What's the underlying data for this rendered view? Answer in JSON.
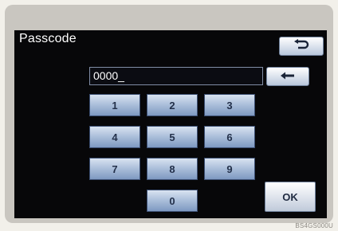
{
  "header": {
    "title": "Passcode",
    "back_icon": "return-arrow-icon"
  },
  "entry": {
    "value": "0000_",
    "backspace_icon": "backspace-arrow-icon"
  },
  "keypad": {
    "k1": "1",
    "k2": "2",
    "k3": "3",
    "k4": "4",
    "k5": "5",
    "k6": "6",
    "k7": "7",
    "k8": "8",
    "k9": "9",
    "k0": "0"
  },
  "ok_label": "OK",
  "figure_code": "BS4GS000U",
  "colors": {
    "screen": "#070709",
    "key": "#a9bdd9",
    "key_border": "#3c4f73"
  }
}
